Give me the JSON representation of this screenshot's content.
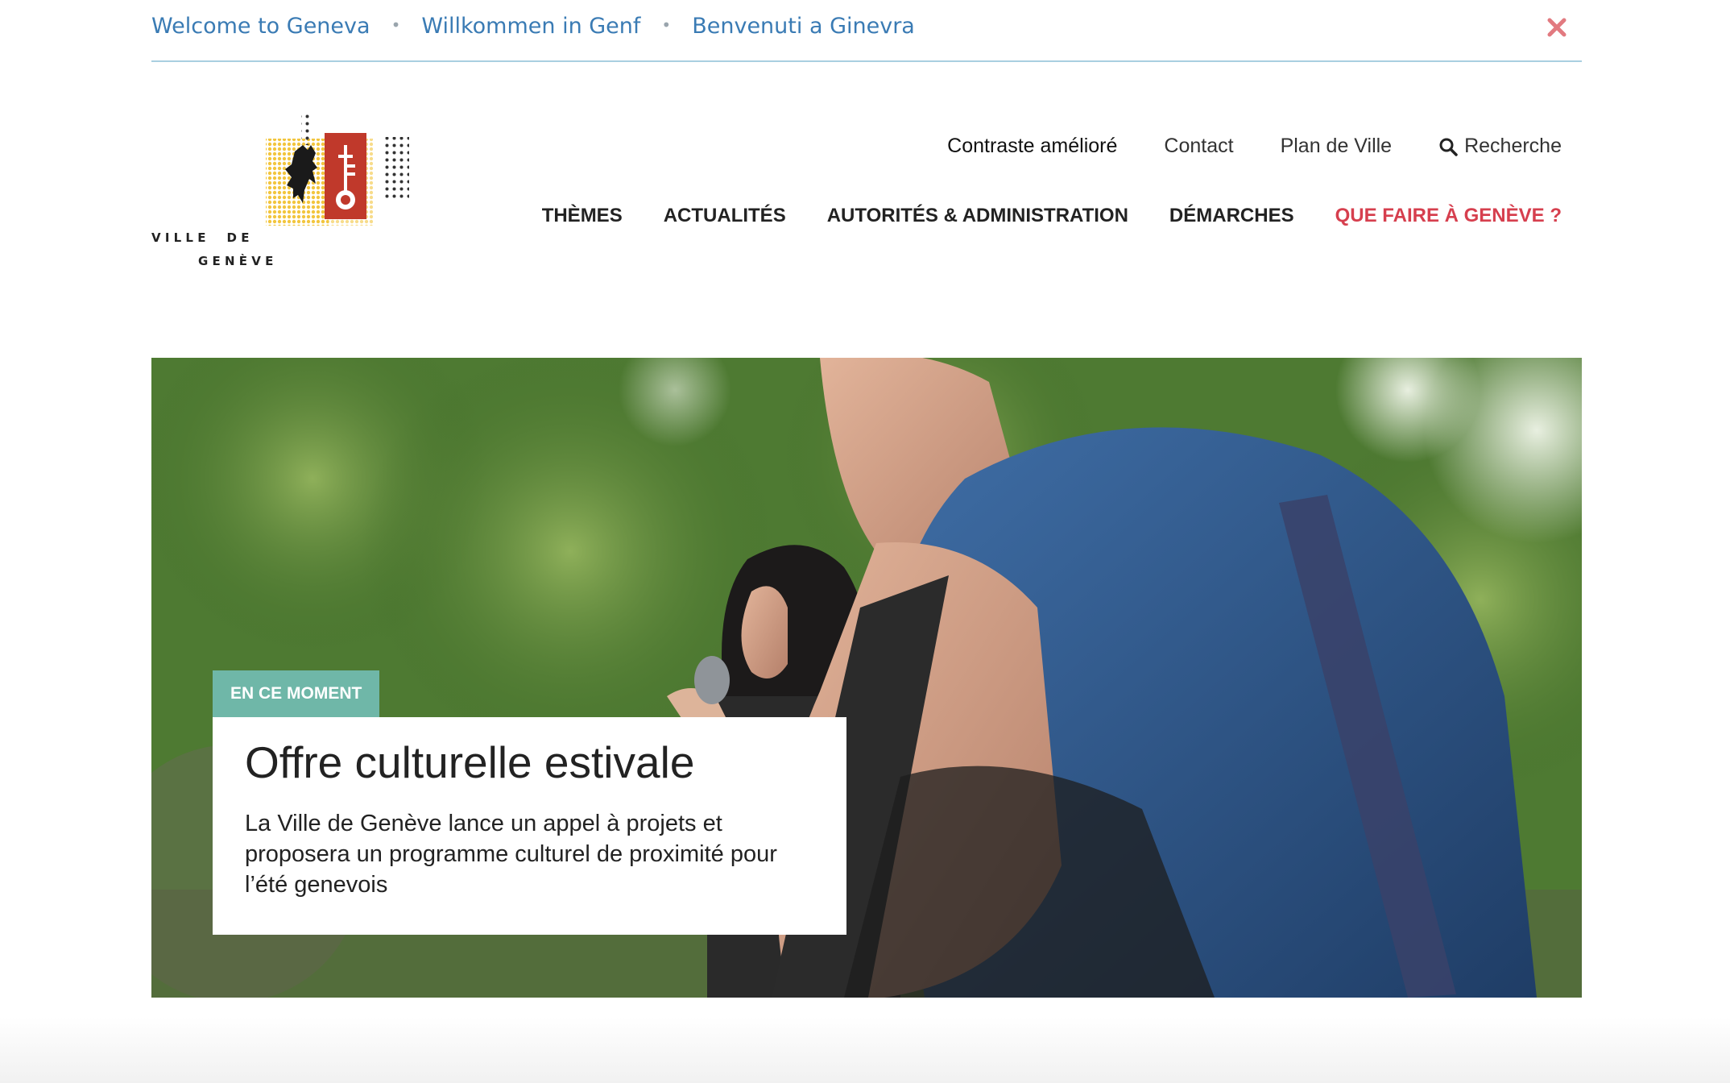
{
  "lang_bar": {
    "links": [
      "Welcome to Geneva",
      "Willkommen in Genf",
      "Benvenuti a Ginevra"
    ],
    "separator": "•",
    "close_icon": "close-x-icon"
  },
  "logo": {
    "line1": "V I L L E     D E",
    "line2": "G E N È V E"
  },
  "utility_nav": {
    "contrast": "Contraste amélioré",
    "contact": "Contact",
    "map": "Plan de Ville",
    "search": "Recherche",
    "search_icon": "search-icon"
  },
  "main_nav": {
    "items": [
      "THÈMES",
      "ACTUALITÉS",
      "AUTORITÉS & ADMINISTRATION",
      "DÉMARCHES",
      "QUE FAIRE À GENÈVE ?"
    ]
  },
  "hero": {
    "tag": "EN CE MOMENT",
    "title": "Offre culturelle estivale",
    "text": "La Ville de Genève lance un appel à projets et proposera un programme culturel de proximité pour l’été genevois"
  },
  "colors": {
    "link_blue": "#3a7bb4",
    "accent_red": "#d63f4e",
    "tag_teal": "#6fb7a8"
  }
}
